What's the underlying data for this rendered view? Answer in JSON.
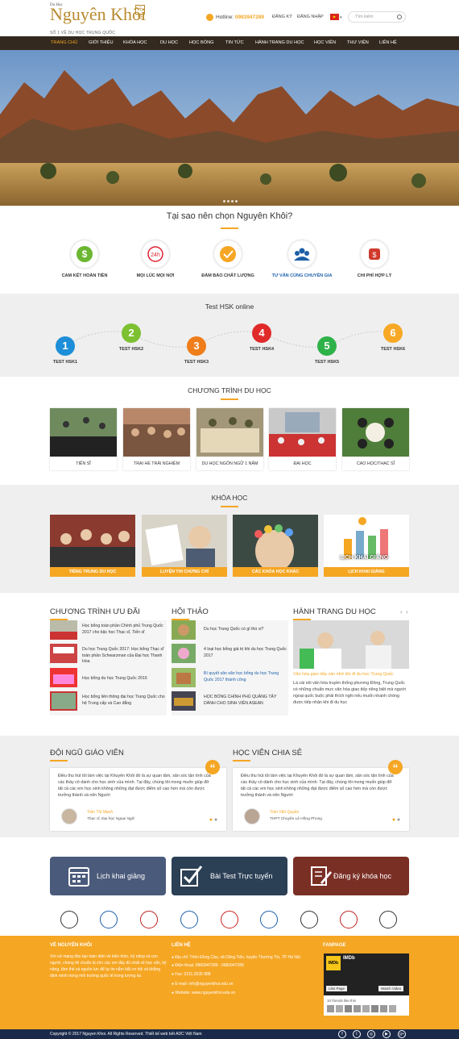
{
  "header": {
    "logo_top": "Du Học",
    "logo_main": "Nguyên Khôi",
    "logo_sub": "SỐ 1 VỀ DU HỌC TRUNG QUỐC",
    "logo_mark": "元魁",
    "hotline_label": "Hotline:",
    "hotline": "0983947289",
    "register": "ĐĂNG KÝ",
    "login": "ĐĂNG NHẬP",
    "search_placeholder": "Tìm kiếm"
  },
  "nav": [
    "TRANG CHỦ",
    "GIỚI THIỆU",
    "KHÓA HỌC",
    "DU HỌC",
    "HỌC BỔNG",
    "TIN TỨC",
    "HÀNH TRANG DU HỌC",
    "HỌC VIÊN",
    "THƯ VIỆN",
    "LIÊN HỆ"
  ],
  "why": {
    "title": "Tại sao nên chọn Nguyên Khôi?",
    "items": [
      "CAM KẾT HOÀN TIỀN",
      "MỌI LÚC MỌI NƠI",
      "ĐẢM BẢO CHẤT LƯỢNG",
      "TƯ VẤN CÙNG CHUYÊN GIA",
      "CHI PHÍ HỢP LÝ"
    ]
  },
  "hsk": {
    "title": "Test HSK online",
    "items": [
      {
        "n": "1",
        "label": "TEST HSK1"
      },
      {
        "n": "2",
        "label": "TEST HSK2"
      },
      {
        "n": "3",
        "label": "TEST HSK3"
      },
      {
        "n": "4",
        "label": "TEST HSK4"
      },
      {
        "n": "5",
        "label": "TEST HSK5"
      },
      {
        "n": "6",
        "label": "TEST HSK6"
      }
    ]
  },
  "programs": {
    "title": "CHƯƠNG TRÌNH DU HỌC",
    "items": [
      "TIẾN SĨ",
      "TRẠI HÈ TRẢI NGHIỆM",
      "DU HỌC NGÔN NGỮ 1 NĂM",
      "ĐẠI HỌC",
      "CAO HỌC/THẠC SĨ"
    ]
  },
  "courses": {
    "title": "KHÓA HỌC",
    "items": [
      "TIẾNG TRUNG DU HỌC",
      "LUYỆN THI CHỨNG CHỈ",
      "CÁC KHÓA HỌC KHÁC",
      "LỊCH KHAI GIẢNG"
    ],
    "banner": "LỊCH KHAI GIẢNG"
  },
  "offers": {
    "title": "CHƯƠNG TRÌNH ƯU ĐÃI",
    "items": [
      "Học bổng toàn phần Chính phủ Trung Quốc 2017 cho bậc học Thạc sĩ, Tiến sĩ",
      "Du học Trung Quốc 2017: Học bổng Thạc sĩ toàn phần Schwarzman của Đại học Thanh Hoa",
      "Học bổng du học Trung Quốc 2016",
      "Học bổng liên thông đại học Trung Quốc cho hệ Trung cấp và Cao đẳng"
    ]
  },
  "seminar": {
    "title": "HỘI THẢO",
    "items": [
      "Du học Trung Quốc có gì thú vị?",
      "4 loại học bổng giá trị khi du học Trung Quốc 2017",
      "Bí quyết săn săn học bổng du học Trung Quốc 2017 thành công",
      "HỌC BỔNG CHÍNH PHỦ QUẢNG TÂY DÀNH CHO SINH VIÊN ASEAN"
    ]
  },
  "journey": {
    "title": "HÀNH TRANG DU HỌC",
    "headline": "Văn hóa giao tiếp cần nhớ khi đi du học Trung Quốc",
    "text": "Là cái nôi văn hóa truyền thống phương Đông, Trung Quốc có những chuẩn mực văn hóa giao tiếp riêng biệt mà người ngoại quốc buộc phải thích nghi nếu muốn nhanh chóng được tiếp nhận khi đi du học"
  },
  "teachers": {
    "title": "ĐỘI NGŨ GIÁO VIÊN",
    "text": "Điều thu hút tôi làm việc tại Khuyên Khôi đó là sự quan tâm, săn sóc tận tình của các thầy cô dành cho học sinh của mình. Tại đây, chúng tôi mong muốn giúp đỡ tất cả các em học sinh không những đạt được điểm số cao hơn mà còn được trưởng thành và nên Người",
    "name": "Trần Thị Mạnh",
    "role": "Thạc sĩ, Đại học Ngoại Ngữ"
  },
  "students": {
    "title": "HỌC VIÊN CHIA SẺ",
    "text": "Điều thu hút tôi làm việc tại Khuyên Khôi đó là sự quan tâm, săn sóc tận tình của các thầy cô dành cho học sinh của mình. Tại đây, chúng tôi mong muốn giúp đỡ tất cả các em học sinh không những đạt được điểm số cao hơn mà còn được trưởng thành và nên Người",
    "name": "Trần Văn Quyền",
    "role": "THPT Chuyên Lê Hồng Phong"
  },
  "cta": {
    "schedule": "Lịch khai giảng",
    "test": "Bài Test Trực tuyến",
    "register": "Đăng ký khóa học",
    "colors": [
      "#4a5a7a",
      "#2b3f55",
      "#7a2f25"
    ]
  },
  "footer": {
    "about_h": "VỀ NGUYÊN KHÔI",
    "about": "Với sứ mạng đào tạo toàn diện về kiến thức, kỹ năng và con người, chúng tôi chuẩn bị cho các em đầy đủ nhất về học vấn, kỹ năng, tâm thế và nguồn lực để tự tin nắm bắt cơ hội và khẳng định mình trong môi trường quốc tế trong tương lai.",
    "contact_h": "LIÊN HỆ",
    "address": "Địa chỉ: Thôn Đồng Cầu, xã Dũng Tiến, huyện Thường Tín, TP Hà Nội",
    "phone": "Điện thoại: 0983947289 - 0983947289",
    "fax": "Fax: 0211.3535 888",
    "email": "E-mail: info@nguyenkhoi.edu.vn",
    "website": "Website: www.nguyenkhoi.edu.vn",
    "fanpage_h": "FANPAGE",
    "fb_name": "IMDb",
    "fb_like": "Like Page",
    "fb_video": "Watch Video",
    "fb_friends": "10 friends like this",
    "copyright": "Copyright © 2017 Nguyen Khoi. All Rights Reserved. Thiết kế web bởi ADC Việt Nam"
  },
  "colors": {
    "accent": "#f5a623",
    "nav_bg": "#33291f",
    "footer_bottom": "#1b2a4a"
  }
}
